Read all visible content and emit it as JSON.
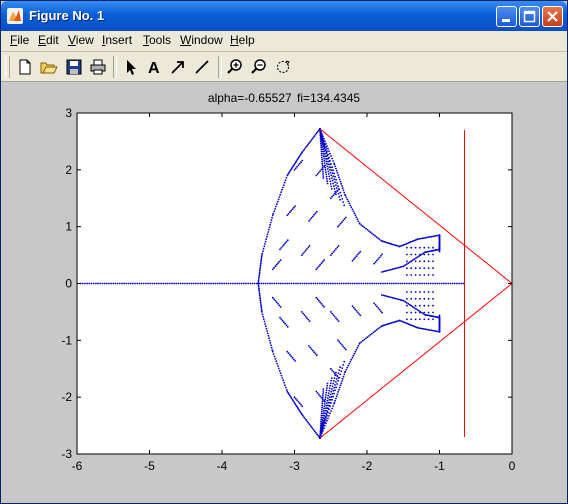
{
  "window": {
    "title": "Figure No. 1",
    "icon": "matlab-icon",
    "buttons": [
      "minimize-icon",
      "maximize-icon",
      "close-icon"
    ]
  },
  "menu": {
    "items": [
      {
        "label": "File",
        "key": "F",
        "rest": "ile"
      },
      {
        "label": "Edit",
        "key": "E",
        "rest": "dit"
      },
      {
        "label": "View",
        "key": "V",
        "rest": "iew"
      },
      {
        "label": "Insert",
        "key": "I",
        "rest": "nsert"
      },
      {
        "label": "Tools",
        "key": "T",
        "rest": "ools"
      },
      {
        "label": "Window",
        "key": "W",
        "rest": "indow"
      },
      {
        "label": "Help",
        "key": "H",
        "rest": "elp"
      }
    ]
  },
  "toolbar": {
    "icons": [
      "new-file-icon",
      "open-folder-icon",
      "save-icon",
      "print-icon",
      "select-arrow-icon",
      "insert-text-icon",
      "insert-arrow-icon",
      "insert-line-icon",
      "zoom-in-icon",
      "zoom-out-icon",
      "rotate-icon"
    ]
  },
  "colors": {
    "plot_background": "#ffffff",
    "figure_background": "#c8c8c8",
    "points": "#0000cc",
    "lines": "#ff0000"
  },
  "chart_data": {
    "type": "scatter",
    "title": "alpha=-0.65527     fi=134.4345",
    "xlim": [
      -6,
      0
    ],
    "ylim": [
      -3,
      3
    ],
    "xticks": [
      "-6",
      "-5",
      "-4",
      "-3",
      "-2",
      "-1",
      "0"
    ],
    "yticks": [
      "3",
      "2",
      "1",
      "0",
      "-1",
      "-2",
      "-3"
    ],
    "grid": false,
    "series": [
      {
        "kind": "points",
        "color": "#0000cc",
        "description_shape": "eigenvalue cloud",
        "points_axis": {
          "x_from": -5.95,
          "x_to": -0.65,
          "y": 0
        },
        "outer_arc": [
          [
            -2.65,
            2.72
          ],
          [
            -2.9,
            2.3
          ],
          [
            -3.1,
            1.9
          ],
          [
            -3.3,
            1.2
          ],
          [
            -3.45,
            0.5
          ],
          [
            -3.5,
            0.0
          ],
          [
            -3.45,
            -0.5
          ],
          [
            -3.3,
            -1.2
          ],
          [
            -3.1,
            -1.9
          ],
          [
            -2.9,
            -2.3
          ],
          [
            -2.65,
            -2.72
          ]
        ],
        "inner_right_edge": [
          [
            -2.65,
            2.72
          ],
          [
            -2.45,
            2.1
          ],
          [
            -2.3,
            1.55
          ],
          [
            -2.1,
            1.05
          ],
          [
            -1.8,
            0.75
          ],
          [
            -1.55,
            0.65
          ],
          [
            -1.3,
            0.78
          ],
          [
            -1.0,
            0.85
          ],
          [
            -1.0,
            0.6
          ],
          [
            -1.2,
            0.55
          ],
          [
            -1.5,
            0.3
          ],
          [
            -1.8,
            0.2
          ]
        ],
        "wing_tip_upper": [
          -1.0,
          0.85
        ],
        "wing_tip_lower": [
          -1.0,
          -0.85
        ],
        "top_vertex": [
          -2.65,
          2.72
        ],
        "bottom_vertex": [
          -2.65,
          -2.72
        ]
      },
      {
        "kind": "lines",
        "color": "#ff0000",
        "segments": [
          [
            [
              -2.65,
              2.72
            ],
            [
              0.0,
              0.0
            ]
          ],
          [
            [
              0.0,
              0.0
            ],
            [
              -2.65,
              -2.72
            ]
          ],
          [
            [
              -0.655,
              2.7
            ],
            [
              -0.655,
              -2.7
            ]
          ]
        ]
      }
    ]
  }
}
